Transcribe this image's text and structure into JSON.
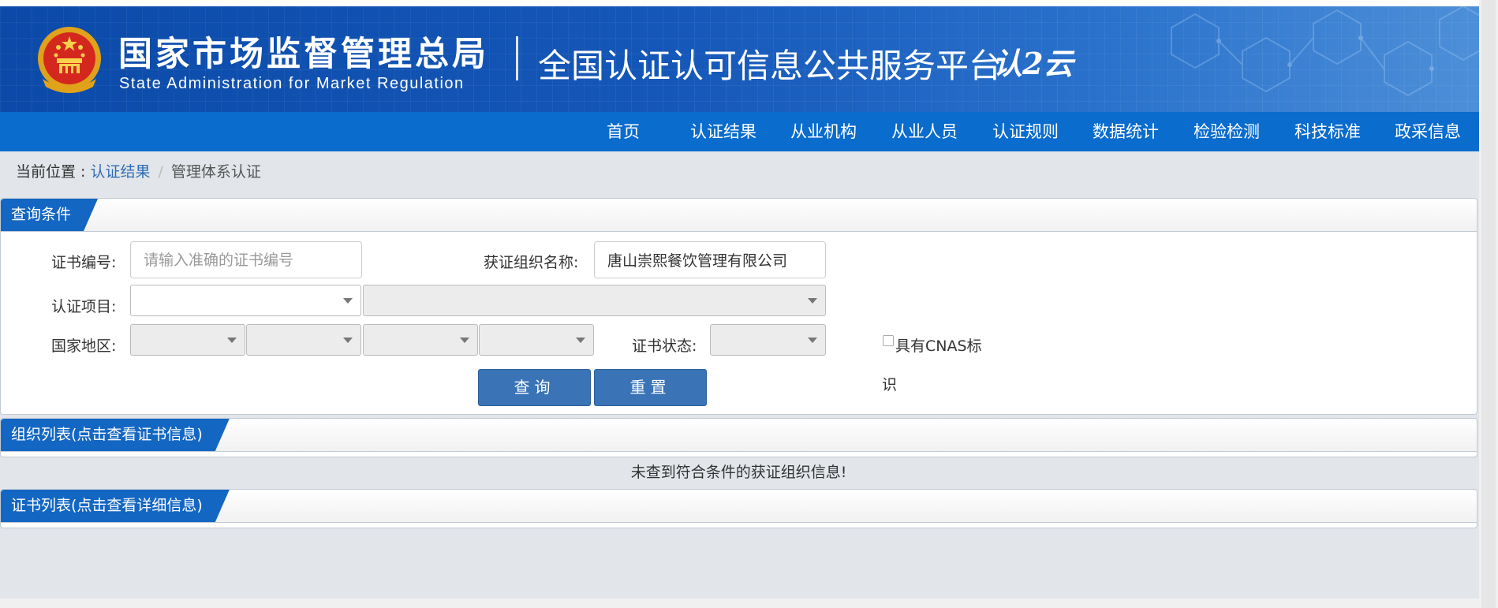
{
  "header": {
    "agency_cn": "国家市场监督管理总局",
    "agency_en": "State Administration  for  Market Regulation",
    "platform_title": "全国认证认可信息公共服务平台",
    "platform_logo": "认2云"
  },
  "nav": {
    "items": [
      "首页",
      "认证结果",
      "从业机构",
      "从业人员",
      "认证规则",
      "数据统计",
      "检验检测",
      "科技标准",
      "政采信息"
    ]
  },
  "breadcrumb": {
    "prefix": "当前位置 : ",
    "link": "认证结果",
    "separator": "/",
    "current": "管理体系认证"
  },
  "query_panel": {
    "title": "查询条件",
    "cert_no_label": "证书编号:",
    "cert_no_placeholder": "请输入准确的证书编号",
    "cert_no_value": "",
    "org_name_label": "获证组织名称:",
    "org_name_value": "唐山崇熙餐饮管理有限公司",
    "project_label": "认证项目:",
    "region_label": "国家地区:",
    "status_label": "证书状态:",
    "cnas_label_line1": "具有CNAS标",
    "cnas_label_line2": "识",
    "cnas_checked": false,
    "search_button": "查询",
    "reset_button": "重置"
  },
  "org_panel": {
    "title": "组织列表(点击查看证书信息)",
    "empty_message": "未查到符合条件的获证组织信息!"
  },
  "cert_panel": {
    "title": "证书列表(点击查看详细信息)"
  },
  "colors": {
    "banner": "#0b4aa8",
    "navbar": "#0a6ccd",
    "panel_tab": "#1367c3",
    "button": "#3a74b7",
    "link": "#2f6db5"
  }
}
